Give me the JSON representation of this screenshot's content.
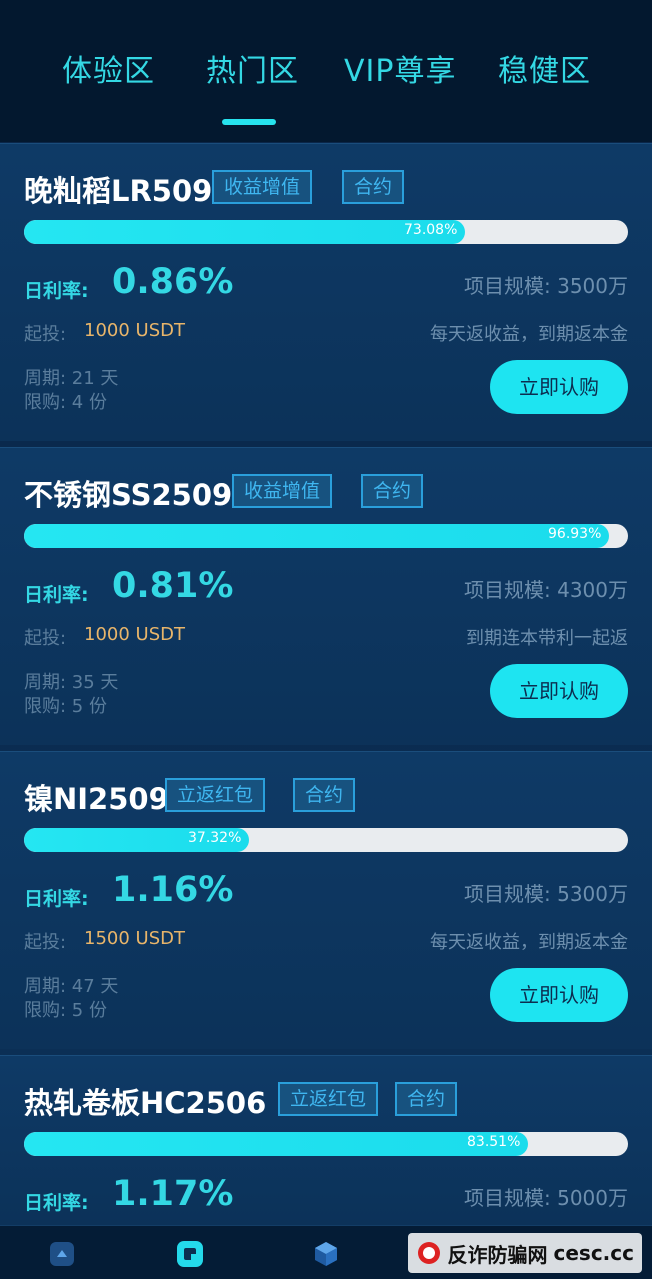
{
  "tabs": [
    {
      "label": "体验区"
    },
    {
      "label": "热门区"
    },
    {
      "label": "VIP尊享"
    },
    {
      "label": "稳健区"
    }
  ],
  "active_tab_index": 1,
  "labels": {
    "rate": "日利率:",
    "scale_prefix": "项目规模:",
    "invest_prefix": "起投:",
    "period_prefix": "周期:",
    "limit_prefix": "限购:",
    "buy": "立即认购"
  },
  "products": [
    {
      "name": "晚籼稻LR509",
      "tags": [
        "收益增值",
        "合约"
      ],
      "progress_text": "73.08%",
      "progress_fraction": 0.7308,
      "rate": "0.86%",
      "scale": "项目规模: 3500万",
      "invest": "1000 USDT",
      "return_desc": "每天返收益，到期返本金",
      "period": "周期: 21 天",
      "limit": "限购: 4 份",
      "buy_label": "立即认购"
    },
    {
      "name": "不锈钢SS2509",
      "tags": [
        "收益增值",
        "合约"
      ],
      "progress_text": "96.93%",
      "progress_fraction": 0.9693,
      "rate": "0.81%",
      "scale": "项目规模: 4300万",
      "invest": "1000 USDT",
      "return_desc": "到期连本带利一起返",
      "period": "周期: 35 天",
      "limit": "限购: 5 份",
      "buy_label": "立即认购"
    },
    {
      "name": "镍NI2509",
      "tags": [
        "立返红包",
        "合约"
      ],
      "progress_text": "37.32%",
      "progress_fraction": 0.3732,
      "rate": "1.16%",
      "scale": "项目规模: 5300万",
      "invest": "1500 USDT",
      "return_desc": "每天返收益，到期返本金",
      "period": "周期: 47 天",
      "limit": "限购: 5 份",
      "buy_label": "立即认购"
    },
    {
      "name": "热轧卷板HC2506",
      "tags": [
        "立返红包",
        "合约"
      ],
      "progress_text": "83.51%",
      "progress_fraction": 0.8351,
      "rate": "1.17%",
      "scale": "项目规模: 5000万"
    }
  ],
  "bottom_nav": {
    "icons": [
      "home-icon",
      "chat-icon",
      "cube-icon"
    ]
  },
  "watermark": {
    "text": "反诈防骗网",
    "url": "cesc.cc"
  },
  "colors": {
    "accent": "#34d8e4",
    "button": "#1ee4f1",
    "invest": "#e8b56a",
    "background": "#0c3259"
  }
}
